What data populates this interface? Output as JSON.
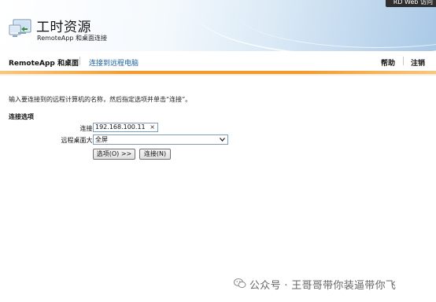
{
  "header": {
    "title": "工时资源",
    "subtitle": "RemoteApp 和桌面连接",
    "top_right": "RD Web 访问"
  },
  "nav": {
    "remoteapp": "RemoteApp 和桌面",
    "connect_remote": "连接到远程电脑",
    "help": "帮助",
    "logout": "注销"
  },
  "main": {
    "instruction": "输入要连接到的远程计算机的名称，然后指定选项并单击“连接”。",
    "section_title": "连接选项",
    "connect_to_label": "连接到(C):",
    "connect_to_value": "192.168.100.11",
    "clear_glyph": "×",
    "desktop_size_label": "远程桌面大小(R):",
    "desktop_size_value": "全屏",
    "options_button": "选项(O) >>",
    "connect_button": "连接(N)"
  },
  "watermark": {
    "text": "公众号 · 王哥哥带你装逼带你飞"
  },
  "colors": {
    "accent_orange": "#f29a2e",
    "link_blue": "#1b5d9c",
    "header_blue": "#aac9e6"
  }
}
